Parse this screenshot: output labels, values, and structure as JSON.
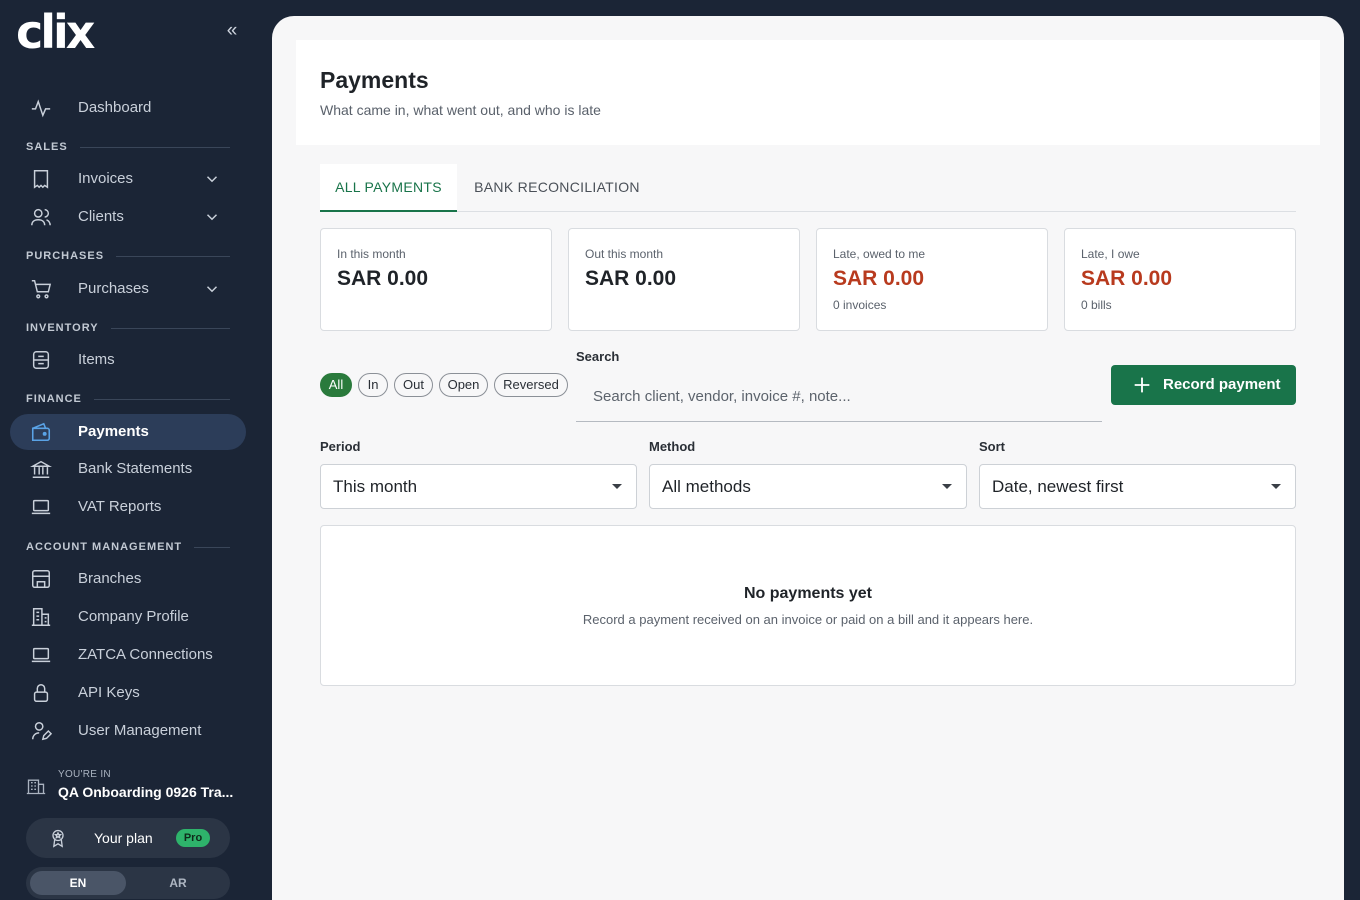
{
  "app": {
    "logo": "clix"
  },
  "sidebar": {
    "collapse_icon": "«",
    "items": [
      {
        "label": "Dashboard",
        "icon": "activity-icon"
      },
      {
        "label": "Invoices",
        "icon": "receipt-icon"
      },
      {
        "label": "Clients",
        "icon": "users-icon"
      },
      {
        "label": "Purchases",
        "icon": "cart-icon"
      },
      {
        "label": "Items",
        "icon": "box-icon"
      },
      {
        "label": "Payments",
        "icon": "wallet-icon",
        "active": true
      },
      {
        "label": "Bank Statements",
        "icon": "bank-icon"
      },
      {
        "label": "VAT Reports",
        "icon": "laptop-icon"
      },
      {
        "label": "Branches",
        "icon": "store-icon"
      },
      {
        "label": "Company Profile",
        "icon": "building-icon"
      },
      {
        "label": "ZATCA Connections",
        "icon": "laptop-icon"
      },
      {
        "label": "API Keys",
        "icon": "lock-icon"
      },
      {
        "label": "User Management",
        "icon": "user-edit-icon"
      }
    ],
    "sections": {
      "sales": "SALES",
      "purchases": "PURCHASES",
      "inventory": "INVENTORY",
      "finance": "FINANCE",
      "account": "ACCOUNT MANAGEMENT"
    },
    "workspace": {
      "label": "YOU'RE IN",
      "name": "QA Onboarding 0926 Tra..."
    },
    "plan": {
      "label": "Your plan",
      "badge": "Pro"
    },
    "lang": {
      "en": "EN",
      "ar": "AR",
      "selected": "EN"
    }
  },
  "page": {
    "title": "Payments",
    "subtitle": "What came in, what went out, and who is late"
  },
  "tabs": [
    {
      "label": "ALL PAYMENTS",
      "active": true
    },
    {
      "label": "BANK RECONCILIATION",
      "active": false
    }
  ],
  "stats": [
    {
      "caption": "In this month",
      "value": "SAR 0.00",
      "sub": ""
    },
    {
      "caption": "Out this month",
      "value": "SAR 0.00",
      "sub": ""
    },
    {
      "caption": "Late, owed to me",
      "value": "SAR 0.00",
      "sub": "0 invoices"
    },
    {
      "caption": "Late, I owe",
      "value": "SAR 0.00",
      "sub": "0 bills"
    }
  ],
  "filters": {
    "chips": [
      "All",
      "In",
      "Out",
      "Open",
      "Reversed"
    ],
    "selected": "All"
  },
  "search": {
    "label": "Search",
    "placeholder": "Search client, vendor, invoice #, note...",
    "value": ""
  },
  "record_button": {
    "label": "Record payment"
  },
  "selects": {
    "period": {
      "label": "Period",
      "value": "This month"
    },
    "method": {
      "label": "Method",
      "value": "All methods"
    },
    "sort": {
      "label": "Sort",
      "value": "Date, newest first"
    }
  },
  "empty_state": {
    "title": "No payments yet",
    "text": "Record a payment received on an invoice or paid on a bill and it appears here."
  },
  "colors": {
    "accent": "#19744a",
    "sidebar": "#1b2536",
    "late": "#b83a1e",
    "pro_badge": "#2eb36b"
  }
}
